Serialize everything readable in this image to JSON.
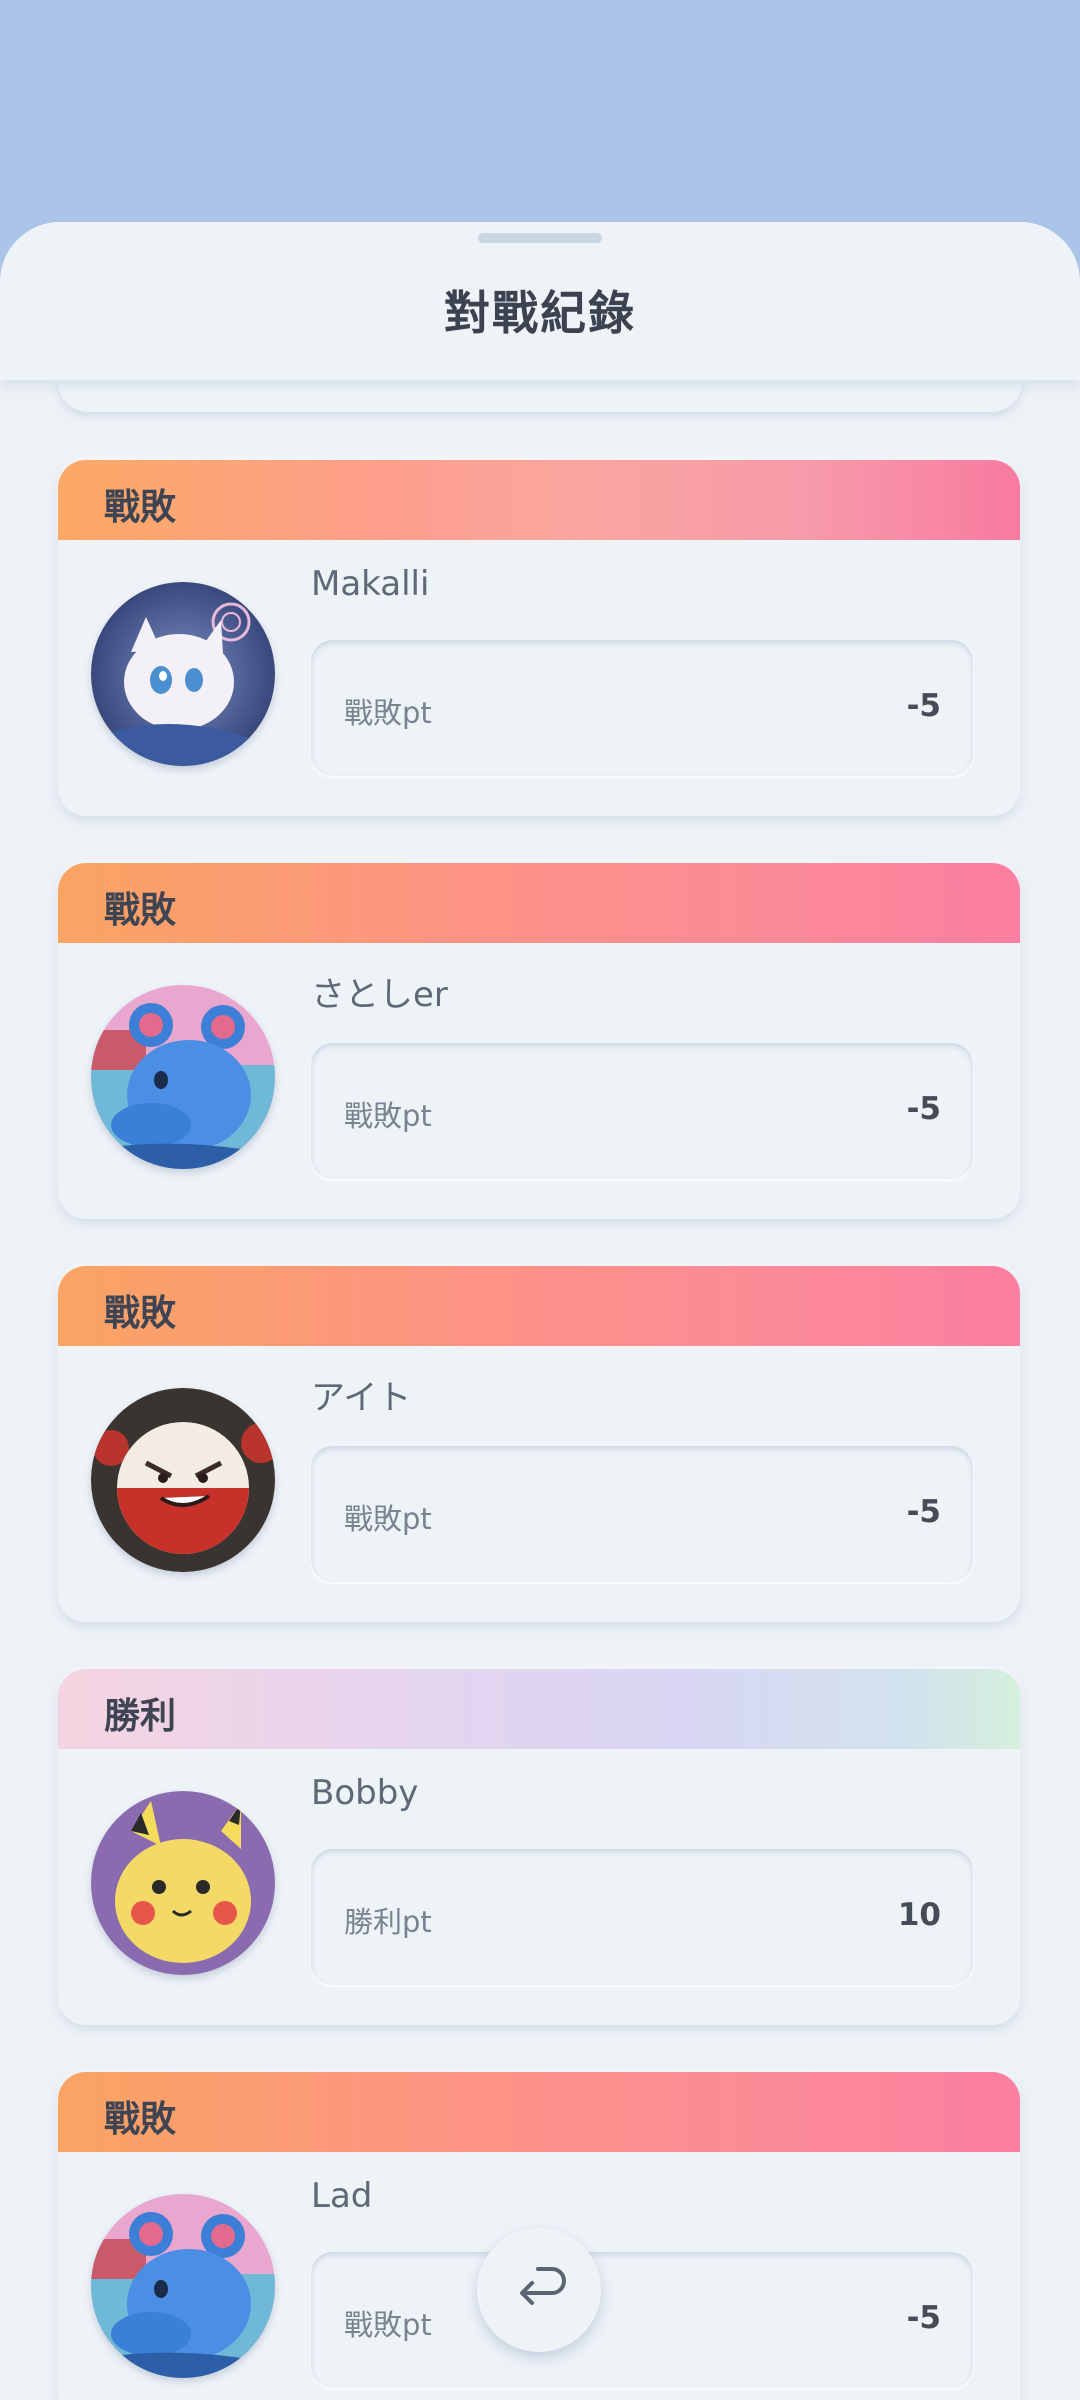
{
  "sheet": {
    "title": "對戰紀錄"
  },
  "matches": [
    {
      "result": "戰敗",
      "result_type": "loss",
      "player": "Makalli",
      "stat_label": "戰敗pt",
      "stat_value": "-5",
      "avatar": "mew-avatar"
    },
    {
      "result": "戰敗",
      "result_type": "loss",
      "player": "さとしer",
      "stat_label": "戰敗pt",
      "stat_value": "-5",
      "avatar": "marill-avatar"
    },
    {
      "result": "戰敗",
      "result_type": "loss",
      "player": "アイト",
      "stat_label": "戰敗pt",
      "stat_value": "-5",
      "avatar": "electrode-avatar"
    },
    {
      "result": "勝利",
      "result_type": "win",
      "player": "Bobby",
      "stat_label": "勝利pt",
      "stat_value": "10",
      "avatar": "pikachu-avatar"
    },
    {
      "result": "戰敗",
      "result_type": "loss",
      "player": "Lad",
      "stat_label": "戰敗pt",
      "stat_value": "-5",
      "avatar": "marill-avatar"
    }
  ],
  "back_button": {
    "icon": "return-arrow-icon"
  },
  "colors": {
    "loss_banner": [
      "#f9a463",
      "#fd9286",
      "#fb7fa0"
    ],
    "win_banner": [
      "#f4d4e0",
      "#d8d6f3",
      "#d4f0dc"
    ],
    "sheet_bg": "#edf2f7",
    "page_bg": "#a9c4e8"
  }
}
